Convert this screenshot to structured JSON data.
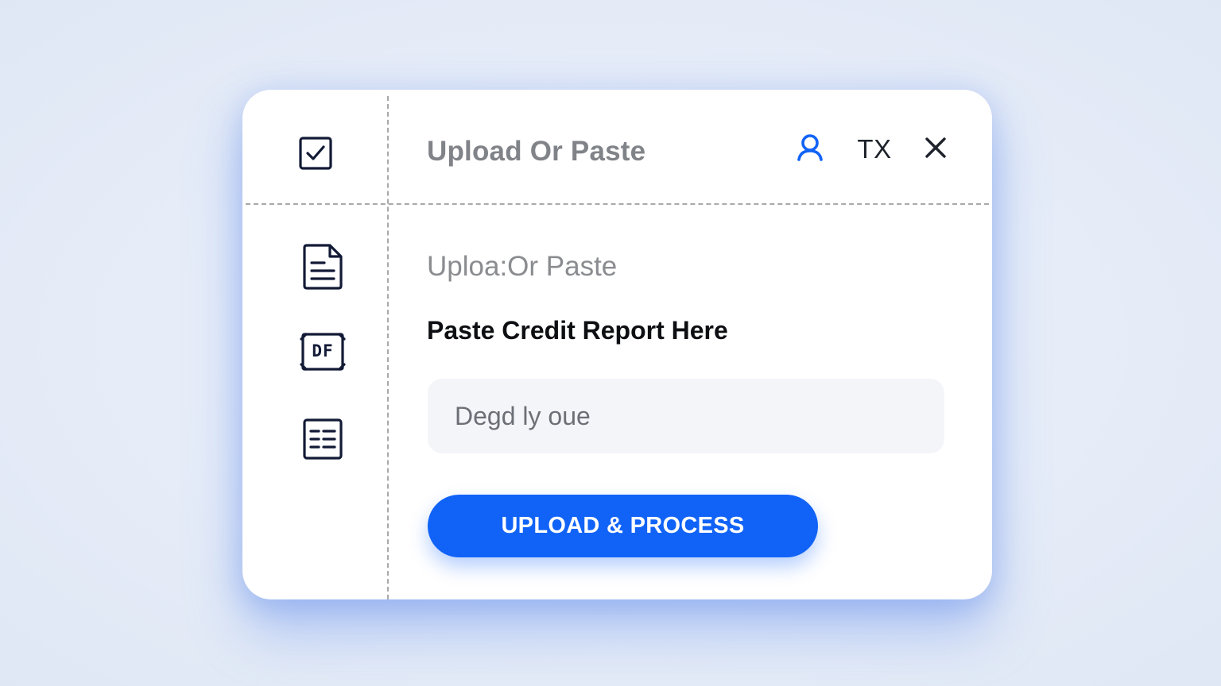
{
  "header": {
    "title": "Upload Or Paste",
    "state_label": "TX",
    "user_icon": "user-icon",
    "close_icon": "close-icon",
    "accent_color": "#1163f7"
  },
  "sidebar": {
    "items": [
      {
        "id": "checklist",
        "icon": "checkbox-icon"
      },
      {
        "id": "document",
        "icon": "document-icon"
      },
      {
        "id": "pdf",
        "icon": "pdf-icon",
        "icon_text": "DF"
      },
      {
        "id": "table",
        "icon": "table-list-icon"
      }
    ]
  },
  "main": {
    "subtitle": "Uploa:Or Paste",
    "heading": "Paste Credit Report Here",
    "input": {
      "placeholder": "Deɡd ly oue",
      "value": ""
    },
    "primary_button": {
      "label": "UPLOAD & PROCESS",
      "color": "#1163f7"
    }
  }
}
